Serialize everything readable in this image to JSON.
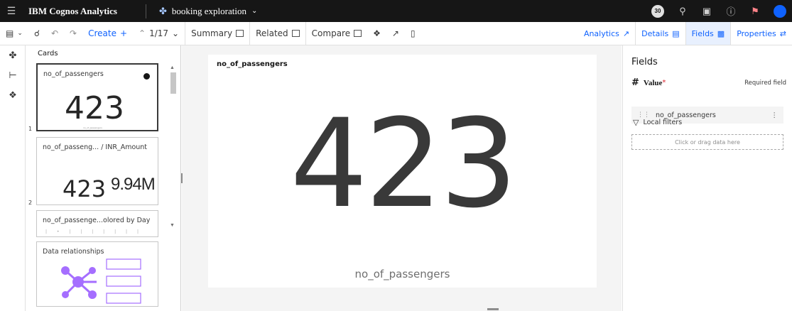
{
  "topbar": {
    "app_name": "IBM Cognos Analytics",
    "doc_name": "booking exploration",
    "notification_count": "30",
    "colors": {
      "background": "#161616",
      "accent": "#0f62fe"
    }
  },
  "toolbar": {
    "create_label": "Create",
    "pager": "1/17",
    "summary_label": "Summary",
    "related_label": "Related",
    "compare_label": "Compare",
    "analytics_label": "Analytics",
    "details_label": "Details",
    "fields_label": "Fields",
    "properties_label": "Properties"
  },
  "cards_panel": {
    "title": "Cards",
    "cards": [
      {
        "index": "1",
        "title": "no_of_passengers",
        "value": "423",
        "caption": "no_of_passengers"
      },
      {
        "index": "2",
        "title": "no_of_passeng... / INR_Amount",
        "value_a": "423",
        "value_b": "9.94M"
      },
      {
        "index": "",
        "title": "no_of_passenge...olored by Day"
      },
      {
        "index": "",
        "title": "Data relationships"
      }
    ]
  },
  "visualization": {
    "title": "no_of_passengers",
    "value": "423",
    "label": "no_of_passengers"
  },
  "properties_panel": {
    "title": "Fields",
    "value_label": "Value",
    "required_star": "*",
    "required_text": "Required field",
    "field_name": "no_of_passengers",
    "local_filters_label": "Local filters",
    "dropzone_text": "Click or drag data here"
  }
}
